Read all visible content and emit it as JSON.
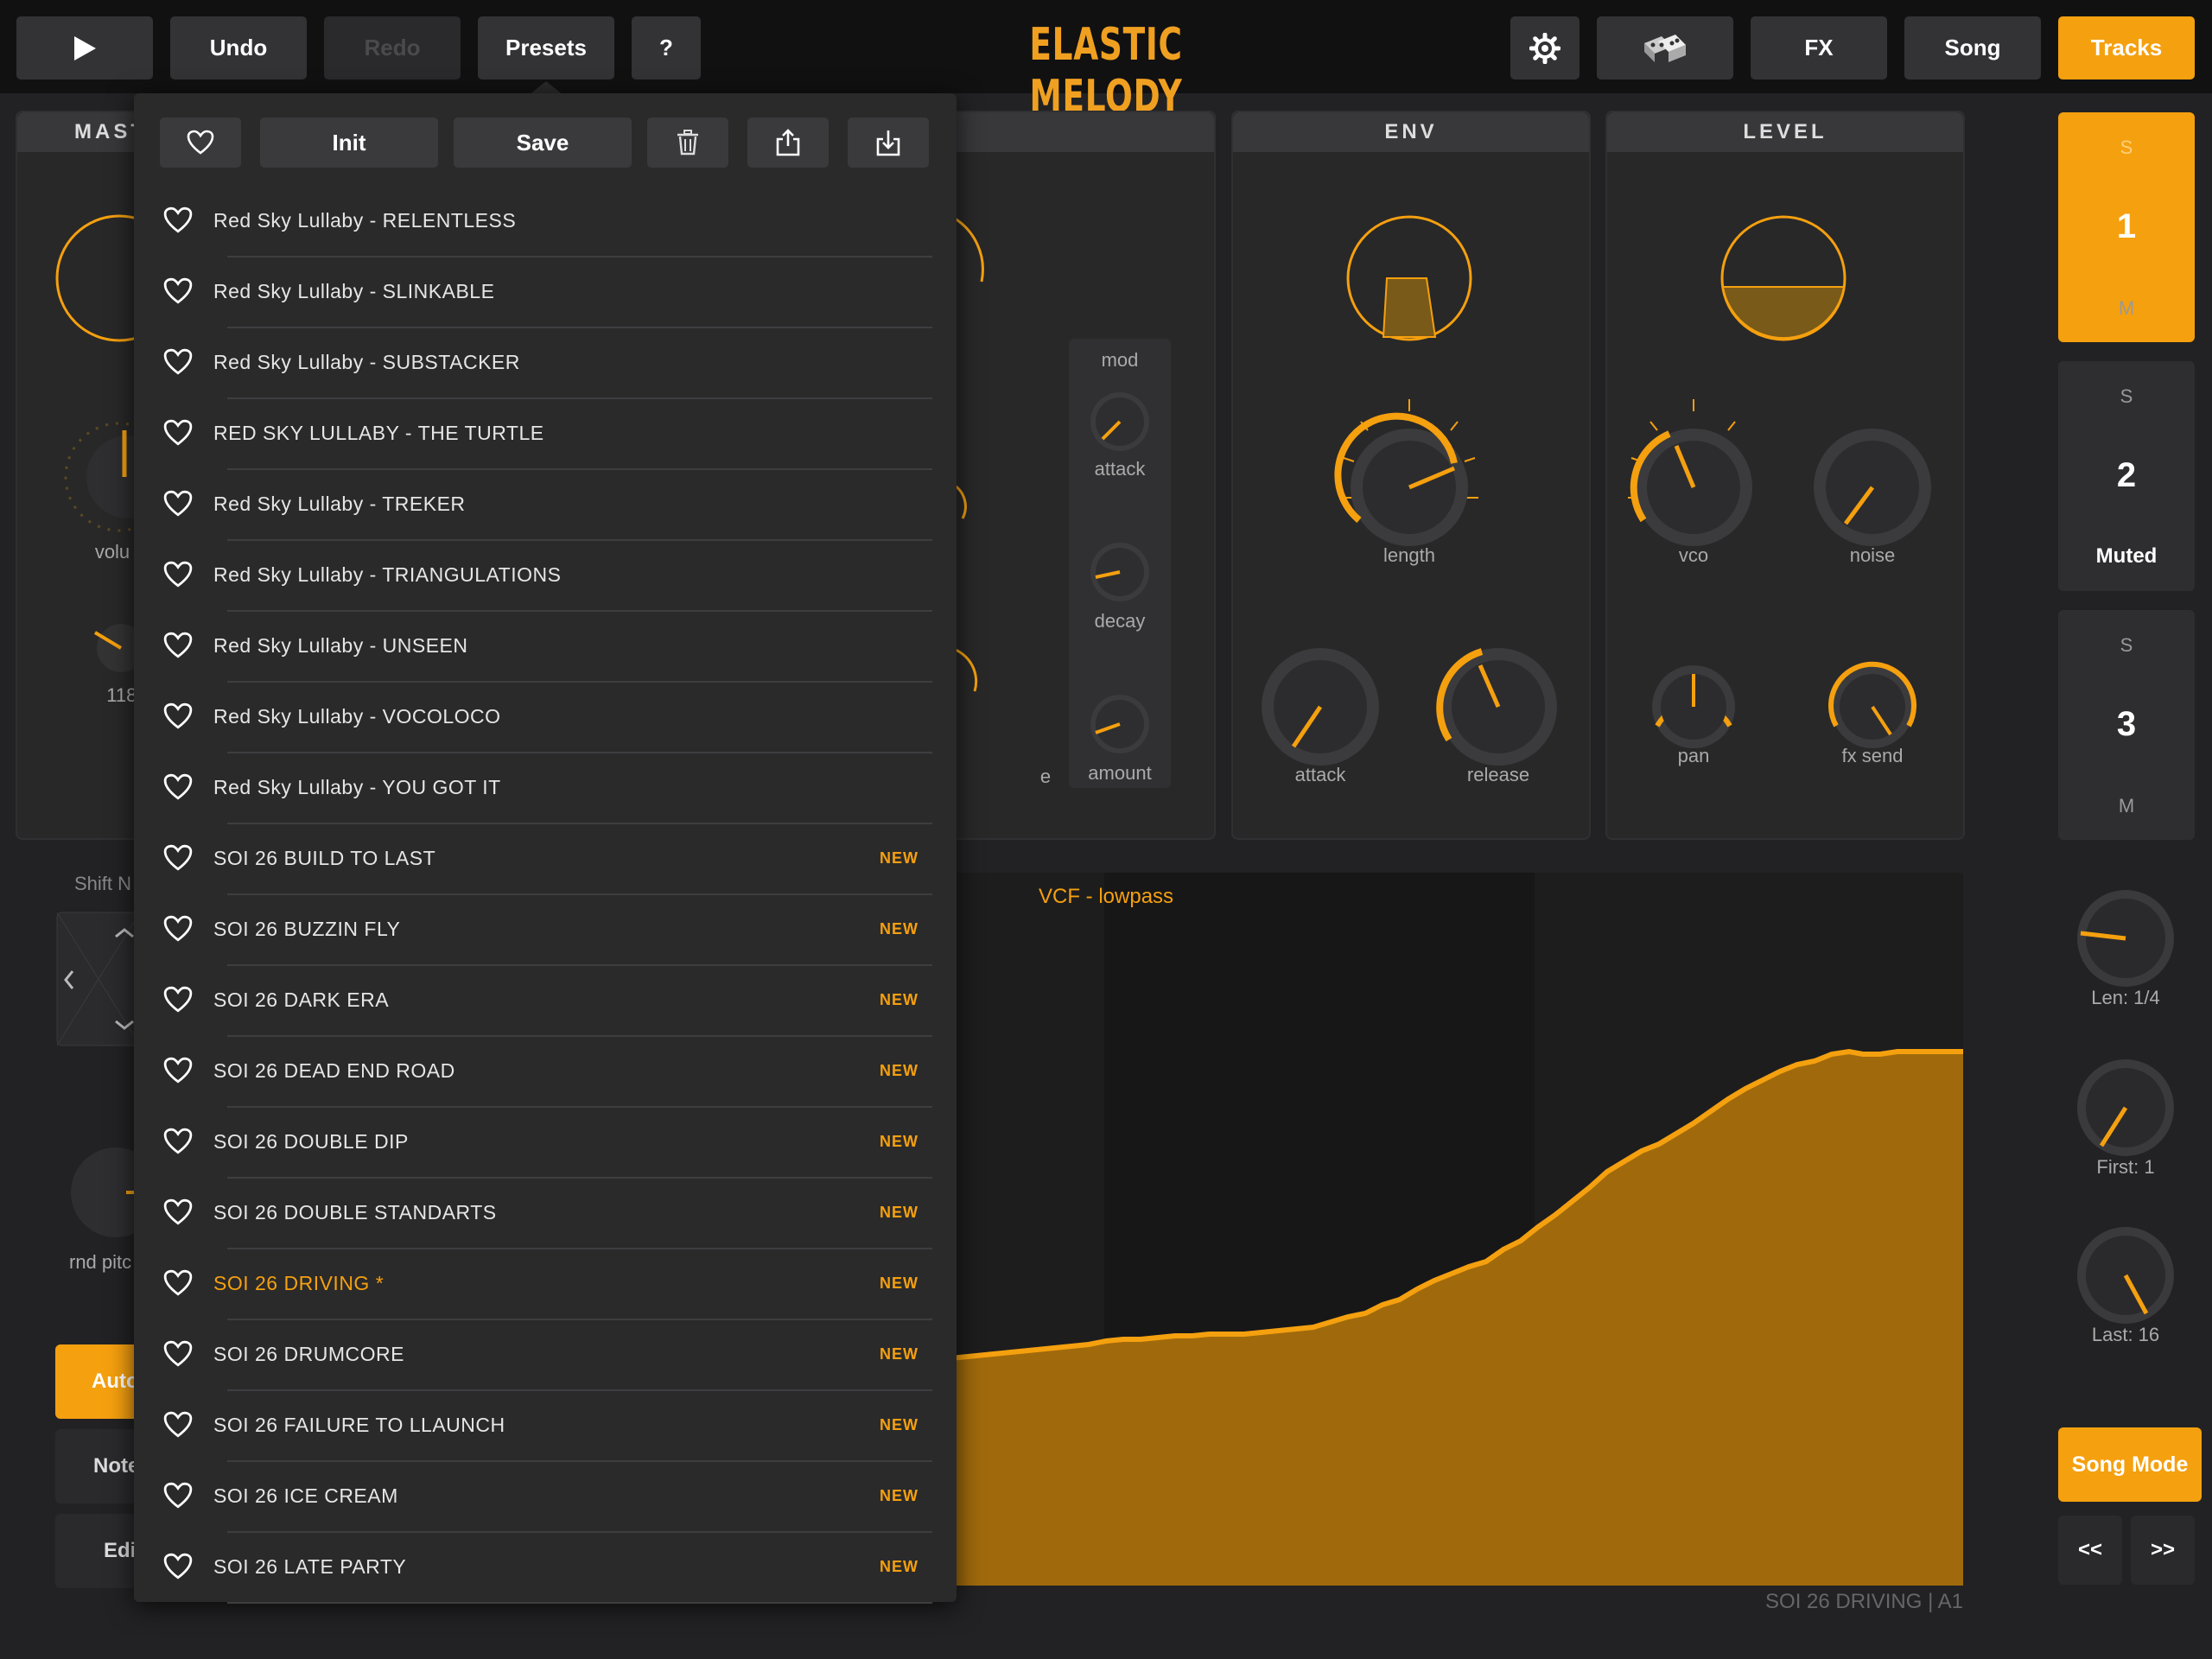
{
  "app": {
    "title": "ELASTIC MELODY"
  },
  "toolbar": {
    "play_icon": "play-icon",
    "undo": "Undo",
    "redo": "Redo",
    "presets": "Presets",
    "help": "?",
    "settings_icon": "gear-icon",
    "randomize_icon": "dice-icon",
    "fx": "FX",
    "song": "Song",
    "tracks": "Tracks"
  },
  "background_panels": {
    "master_partial": "MAST",
    "env": "ENV",
    "level": "LEVEL",
    "mod_group": "mod",
    "knobs": {
      "master_volume_partial": "volu",
      "tempo_partial": "118 b",
      "mod_attack": "attack",
      "mod_decay": "decay",
      "mod_amount": "amount",
      "env_length": "length",
      "env_attack": "attack",
      "env_release": "release",
      "level_vco": "vco",
      "level_noise": "noise",
      "level_pan": "pan",
      "level_fx_send": "fx send",
      "partial_e": "e"
    },
    "shift_partial": "Shift N",
    "rnd_pitch_partial": "rnd pitc",
    "mode_buttons_partial": [
      "Auto",
      "Note",
      "Edi"
    ]
  },
  "graph": {
    "label": "VCF - lowpass",
    "accent": "#f5a00f"
  },
  "tracks": [
    {
      "solo": "S",
      "number": "1",
      "mute": "M",
      "active": true
    },
    {
      "solo": "S",
      "number": "2",
      "status": "Muted",
      "active": false
    },
    {
      "solo": "S",
      "number": "3",
      "mute": "M",
      "active": false
    }
  ],
  "right_controls": {
    "len": "Len: 1/4",
    "first": "First: 1",
    "last": "Last: 16",
    "song_mode": "Song Mode",
    "prev": "<<",
    "next": ">>"
  },
  "footer": {
    "status": "SOI 26 DRIVING  |  A1"
  },
  "presets_menu": {
    "favorite_icon": "heart-icon",
    "init": "Init",
    "save": "Save",
    "delete_icon": "trash-icon",
    "share_icon": "share-icon",
    "import_icon": "import-icon",
    "items": [
      {
        "name": "Red Sky Lullaby - RELENTLESS",
        "badge": ""
      },
      {
        "name": "Red Sky Lullaby - SLINKABLE",
        "badge": ""
      },
      {
        "name": "Red Sky Lullaby - SUBSTACKER",
        "badge": ""
      },
      {
        "name": "RED SKY LULLABY - THE TURTLE",
        "badge": ""
      },
      {
        "name": "Red Sky Lullaby - TREKER",
        "badge": ""
      },
      {
        "name": "Red Sky Lullaby - TRIANGULATIONS",
        "badge": ""
      },
      {
        "name": "Red Sky Lullaby - UNSEEN",
        "badge": ""
      },
      {
        "name": "Red Sky Lullaby - VOCOLOCO",
        "badge": ""
      },
      {
        "name": "Red Sky Lullaby - YOU GOT IT",
        "badge": ""
      },
      {
        "name": "SOI 26 BUILD TO LAST",
        "badge": "NEW"
      },
      {
        "name": "SOI 26 BUZZIN FLY",
        "badge": "NEW"
      },
      {
        "name": "SOI 26 DARK ERA",
        "badge": "NEW"
      },
      {
        "name": "SOI 26 DEAD END ROAD",
        "badge": "NEW"
      },
      {
        "name": "SOI 26 DOUBLE DIP",
        "badge": "NEW"
      },
      {
        "name": "SOI 26 DOUBLE STANDARTS",
        "badge": "NEW"
      },
      {
        "name": "SOI 26 DRIVING *",
        "badge": "NEW",
        "current": true
      },
      {
        "name": "SOI 26 DRUMCORE",
        "badge": "NEW"
      },
      {
        "name": "SOI 26 FAILURE TO LLAUNCH",
        "badge": "NEW"
      },
      {
        "name": "SOI 26 ICE CREAM",
        "badge": "NEW"
      },
      {
        "name": "SOI 26 LATE PARTY",
        "badge": "NEW"
      }
    ]
  }
}
